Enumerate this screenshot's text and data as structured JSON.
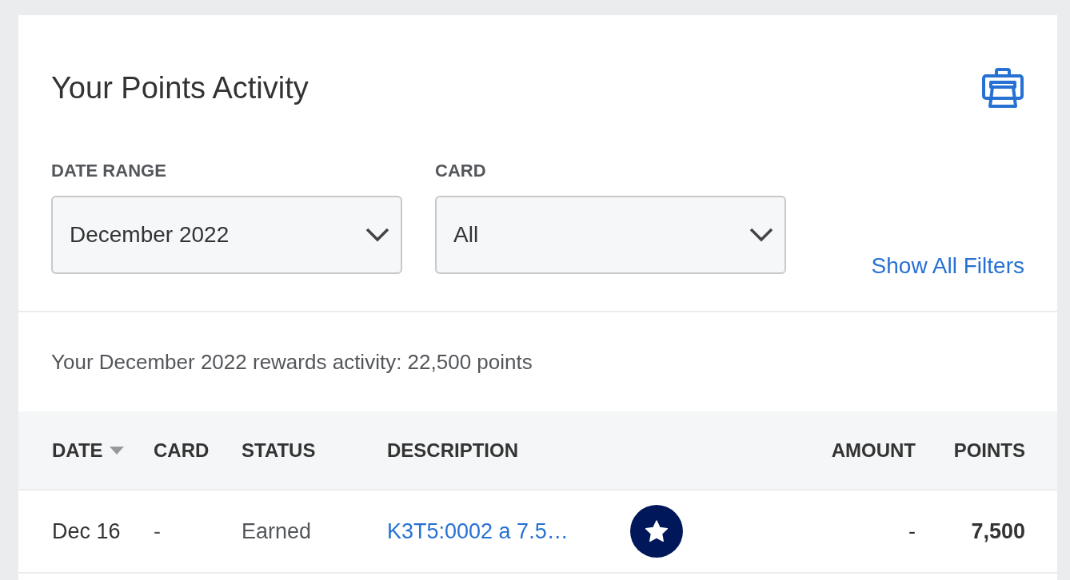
{
  "title": "Your Points Activity",
  "filters": [
    {
      "label": "DATE RANGE",
      "value": "December 2022"
    },
    {
      "label": "CARD",
      "value": "All"
    }
  ],
  "show_all_filters": "Show All Filters",
  "summary": "Your December 2022 rewards activity: 22,500 points",
  "table": {
    "columns": [
      {
        "label": "DATE",
        "sorted": true
      },
      {
        "label": "CARD",
        "sorted": false
      },
      {
        "label": "STATUS",
        "sorted": false
      },
      {
        "label": "DESCRIPTION",
        "sorted": false
      },
      {
        "label": "AMOUNT",
        "sorted": false
      },
      {
        "label": "POINTS",
        "sorted": false
      }
    ],
    "rows": [
      {
        "date": "Dec 16",
        "card": "-",
        "status": "Earned",
        "description": "K3T5:0002 a 7.5…",
        "featured": true,
        "amount": "-",
        "points": "7,500"
      }
    ]
  }
}
